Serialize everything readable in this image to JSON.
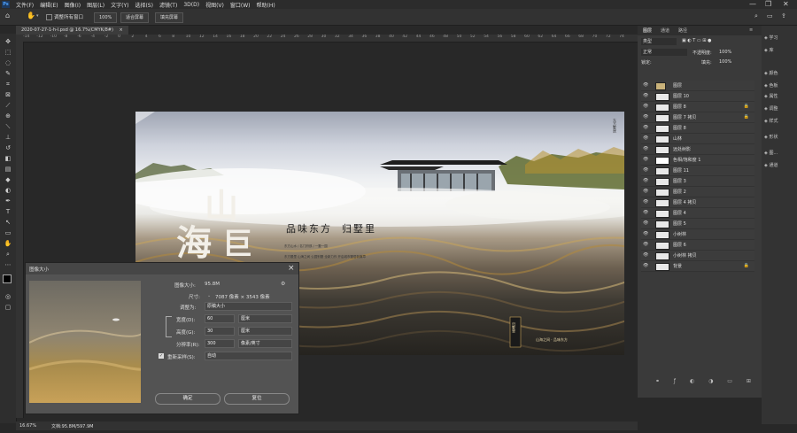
{
  "menubar": {
    "logo": "Ps",
    "items": [
      "文件(F)",
      "编辑(E)",
      "图像(I)",
      "图层(L)",
      "文字(Y)",
      "选择(S)",
      "滤镜(T)",
      "3D(D)",
      "视图(V)",
      "窗口(W)",
      "帮助(H)"
    ],
    "minimize": "—",
    "maximize": "❐",
    "close": "✕"
  },
  "options": {
    "resize_all_label": "调整所有窗口",
    "zoom_value": "100%",
    "fit_screen": "适合屏幕",
    "fill_screen": "填充屏幕"
  },
  "document": {
    "tab_title": "2020-07-27-1-h-l.psd @ 16.7%(CMYK/8#)",
    "tab_close": "×",
    "status_zoom": "16.67%",
    "status_doc": "文档:95.8M/597.9M"
  },
  "ruler": {
    "top_ticks": [
      "-14",
      "-12",
      "-10",
      "-8",
      "-6",
      "-4",
      "-2",
      "0",
      "2",
      "4",
      "6",
      "8",
      "10",
      "12",
      "14",
      "16",
      "18",
      "20",
      "22",
      "24",
      "26",
      "28",
      "30",
      "32",
      "34",
      "36",
      "38",
      "40",
      "42",
      "44",
      "46",
      "48",
      "50",
      "52",
      "54",
      "56",
      "58",
      "60",
      "62",
      "64",
      "66",
      "68",
      "70",
      "72",
      "74"
    ]
  },
  "artwork": {
    "title_char_1": "山",
    "title_char_2": "海",
    "title_char_3": "巨",
    "slogan": "品味东方  归墅里",
    "small_text_1": "东方山水 / 名门府邸 / 一墅一园",
    "small_text_2": "东方墅里 山海之间 公园别墅 全新力作 开启城市墅居新篇章",
    "small_text_3": "山海之间 · 品味东方",
    "logo_label": "归墅里",
    "side_text": "东方墅居"
  },
  "layers_panel": {
    "tabs": [
      "图层",
      "通道",
      "路径"
    ],
    "kind_label": "类型",
    "blend_mode": "正常",
    "opacity_label": "不透明度:",
    "opacity_value": "100%",
    "lock_label": "锁定:",
    "fill_label": "填充:",
    "fill_value": "100%",
    "layers": [
      {
        "name": "图层",
        "kind": "folder",
        "locked": false
      },
      {
        "name": "图层 10",
        "kind": "layer",
        "locked": false
      },
      {
        "name": "图层 8",
        "kind": "layer",
        "locked": true
      },
      {
        "name": "图层 7 拷贝",
        "kind": "layer",
        "locked": true
      },
      {
        "name": "图层 8",
        "kind": "layer",
        "locked": false
      },
      {
        "name": "山林",
        "kind": "layer",
        "locked": false
      },
      {
        "name": "远处树影",
        "kind": "layer",
        "locked": false
      },
      {
        "name": "色相/饱和度 1",
        "kind": "adjust",
        "locked": false
      },
      {
        "name": "图层 11",
        "kind": "layer",
        "locked": false
      },
      {
        "name": "图层 3",
        "kind": "layer",
        "locked": false
      },
      {
        "name": "图层 2",
        "kind": "layer",
        "locked": false
      },
      {
        "name": "图层 4 拷贝",
        "kind": "layer",
        "locked": false
      },
      {
        "name": "图层 4",
        "kind": "layer",
        "locked": false
      },
      {
        "name": "图层 5",
        "kind": "layer",
        "locked": false
      },
      {
        "name": "小树林",
        "kind": "layer",
        "locked": false
      },
      {
        "name": "图层 6",
        "kind": "layer",
        "locked": false
      },
      {
        "name": "小树林 拷贝",
        "kind": "layer",
        "locked": false
      },
      {
        "name": "背景",
        "kind": "layer",
        "locked": true
      }
    ],
    "footer_icons": [
      "link",
      "fx",
      "mask",
      "adjust",
      "folder",
      "new",
      "delete"
    ]
  },
  "right_strip": {
    "items": [
      {
        "label": "学习",
        "icon": "learn-icon"
      },
      {
        "label": "库",
        "icon": "library-icon"
      },
      {
        "label": "颜色",
        "icon": "color-icon"
      },
      {
        "label": "色板",
        "icon": "swatches-icon"
      },
      {
        "label": "属性",
        "icon": "properties-icon"
      },
      {
        "label": "调整",
        "icon": "adjustments-icon"
      },
      {
        "label": "样式",
        "icon": "styles-icon"
      },
      {
        "label": "形状",
        "icon": "shapes-icon"
      },
      {
        "label": "图...",
        "icon": "layers-icon"
      },
      {
        "label": "通道",
        "icon": "channels-icon"
      }
    ]
  },
  "dialog": {
    "title": "图像大小",
    "close": "×",
    "image_size_label": "图像大小:",
    "image_size_value": "95.8M",
    "dimensions_label": "尺寸:",
    "dimensions_value": "7087 像素 × 3543 像素",
    "fit_to_label": "调整为:",
    "fit_to_value": "原稿大小",
    "width_label": "宽度(D):",
    "width_value": "60",
    "width_unit": "厘米",
    "height_label": "高度(G):",
    "height_value": "30",
    "height_unit": "厘米",
    "resolution_label": "分辨率(R):",
    "resolution_value": "300",
    "resolution_unit": "像素/英寸",
    "resample_label": "重新采样(S):",
    "resample_value": "自动",
    "ok": "确定",
    "reset": "复位"
  }
}
